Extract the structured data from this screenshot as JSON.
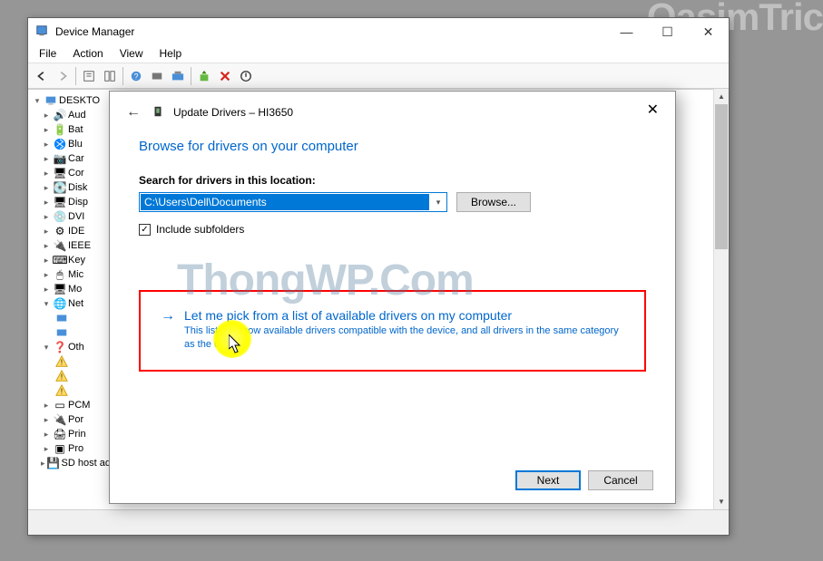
{
  "watermarks": {
    "top": "QasimTric",
    "mid": "ThongWP.Com"
  },
  "window": {
    "title": "Device Manager",
    "menu": [
      "File",
      "Action",
      "View",
      "Help"
    ],
    "win_controls": {
      "min": "—",
      "max": "☐",
      "close": "✕"
    }
  },
  "tree": {
    "root": "DESKTO",
    "items": [
      {
        "label": "Aud",
        "icon": "audio"
      },
      {
        "label": "Bat",
        "icon": "battery",
        "expanded": true
      },
      {
        "label": "Blu",
        "icon": "bluetooth"
      },
      {
        "label": "Car",
        "icon": "camera"
      },
      {
        "label": "Cor",
        "icon": "monitor"
      },
      {
        "label": "Disk",
        "icon": "disk"
      },
      {
        "label": "Disp",
        "icon": "monitor"
      },
      {
        "label": "DVI",
        "icon": "dvd"
      },
      {
        "label": "IDE",
        "icon": "ide"
      },
      {
        "label": "IEEE",
        "icon": "usb"
      },
      {
        "label": "Key",
        "icon": "keyboard"
      },
      {
        "label": "Mic",
        "icon": "mouse"
      },
      {
        "label": "Mo",
        "icon": "monitor"
      },
      {
        "label": "Net",
        "icon": "network",
        "expanded": true,
        "children": 2
      },
      {
        "label": "Oth",
        "icon": "other",
        "expanded": true,
        "children": 3,
        "warn": true
      },
      {
        "label": "PCM",
        "icon": "pcm"
      },
      {
        "label": "Por",
        "icon": "port"
      },
      {
        "label": "Prin",
        "icon": "printer"
      },
      {
        "label": "Pro",
        "icon": "cpu"
      },
      {
        "label": "SD host adapters",
        "icon": "sd"
      }
    ]
  },
  "dialog": {
    "title": "Update Drivers – HI3650",
    "heading": "Browse for drivers on your computer",
    "search_label": "Search for drivers in this location:",
    "path": "C:\\Users\\Dell\\Documents",
    "browse": "Browse...",
    "include_subfolders": "Include subfolders",
    "option": {
      "title": "Let me pick from a list of available drivers on my computer",
      "desc": "This list will show available drivers compatible with the device, and all drivers in the same category as the device."
    },
    "next": "Next",
    "cancel": "Cancel"
  }
}
